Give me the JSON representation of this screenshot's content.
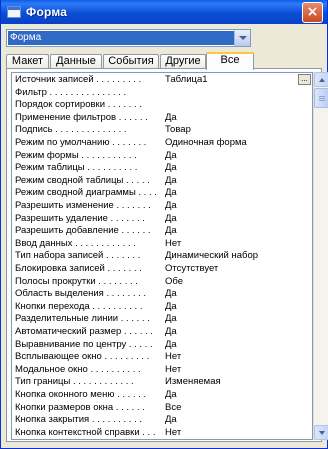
{
  "window": {
    "title": "Форма",
    "close_label": "×"
  },
  "object_selector": {
    "selected": "Форма"
  },
  "tabs": [
    {
      "label": "Макет"
    },
    {
      "label": "Данные"
    },
    {
      "label": "События"
    },
    {
      "label": "Другие"
    },
    {
      "label": "Все"
    }
  ],
  "active_tab": "Все",
  "properties": [
    {
      "name": "Источник записей . . . . . . . . .",
      "value": "Таблица1"
    },
    {
      "name": "Фильтр . . . . . . . . . . . . . . .",
      "value": ""
    },
    {
      "name": "Порядок сортировки . . . . . . .",
      "value": ""
    },
    {
      "name": "Применение фильтров . . . . . .",
      "value": "Да"
    },
    {
      "name": "Подпись . . . . . . . . . . . . . .",
      "value": "Товар"
    },
    {
      "name": "Режим по умолчанию . . . . . . .",
      "value": "Одиночная форма"
    },
    {
      "name": "Режим формы . . . . . . . . . . .",
      "value": "Да"
    },
    {
      "name": "Режим таблицы . . . . . . . . . .",
      "value": "Да"
    },
    {
      "name": "Режим сводной таблицы . . . . .",
      "value": "Да"
    },
    {
      "name": "Режим сводной диаграммы . . . .",
      "value": "Да"
    },
    {
      "name": "Разрешить изменение . . . . . . .",
      "value": "Да"
    },
    {
      "name": "Разрешить удаление . . . . . . .",
      "value": "Да"
    },
    {
      "name": "Разрешить добавление . . . . . .",
      "value": "Да"
    },
    {
      "name": "Ввод данных . . . . . . . . . . . .",
      "value": "Нет"
    },
    {
      "name": "Тип набора записей . . . . . . .",
      "value": "Динамический набор"
    },
    {
      "name": "Блокировка записей . . . . . . .",
      "value": "Отсутствует"
    },
    {
      "name": "Полосы прокрутки . . . . . . . .",
      "value": "Обе"
    },
    {
      "name": "Область выделения . . . . . . . .",
      "value": "Да"
    },
    {
      "name": "Кнопки перехода . . . . . . . . . .",
      "value": "Да"
    },
    {
      "name": "Разделительные линии . . . . . .",
      "value": "Да"
    },
    {
      "name": "Автоматический размер . . . . . .",
      "value": "Да"
    },
    {
      "name": "Выравнивание по центру . . . . .",
      "value": "Да"
    },
    {
      "name": "Всплывающее окно . . . . . . . . .",
      "value": "Нет"
    },
    {
      "name": "Модальное окно . . . . . . . . . .",
      "value": "Нет"
    },
    {
      "name": "Тип границы . . . . . . . . . . . .",
      "value": "Изменяемая"
    },
    {
      "name": "Кнопка оконного меню . . . . . .",
      "value": "Да"
    },
    {
      "name": "Кнопки размеров окна . . . . . .",
      "value": "Все"
    },
    {
      "name": "Кнопка закрытия . . . . . . . . . .",
      "value": "Да"
    },
    {
      "name": "Кнопка контекстной справки . . .",
      "value": "Нет"
    }
  ],
  "builder_button_label": "...",
  "colors": {
    "titlebar": "#0a4fd6",
    "selection": "#316ac5",
    "active_tab_highlight": "#ffc83c"
  }
}
